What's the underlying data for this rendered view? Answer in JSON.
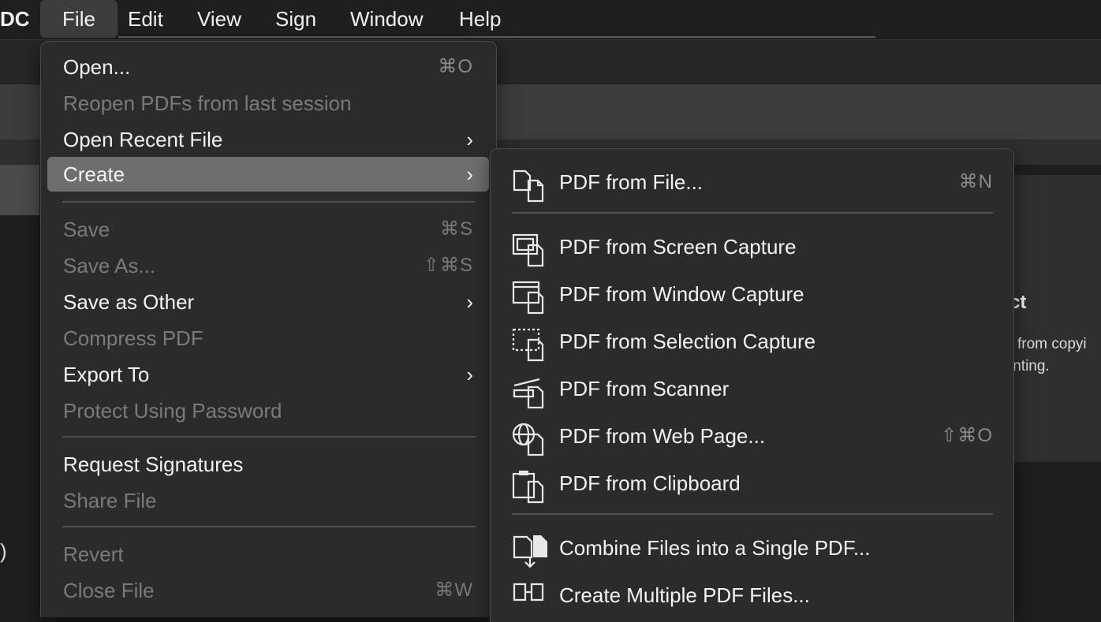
{
  "menubar": {
    "app_name": "DC",
    "items": [
      "File",
      "Edit",
      "View",
      "Sign",
      "Window",
      "Help"
    ]
  },
  "background": {
    "left_glyph": ")",
    "card_title_fragment": "ct",
    "card_text_line1": "from copyi",
    "card_text_line2": "inting."
  },
  "file_menu": {
    "open": {
      "label": "Open...",
      "shortcut": "⌘O"
    },
    "reopen": {
      "label": "Reopen PDFs from last session"
    },
    "open_recent": {
      "label": "Open Recent File"
    },
    "create": {
      "label": "Create"
    },
    "save": {
      "label": "Save",
      "shortcut": "⌘S"
    },
    "save_as": {
      "label": "Save As...",
      "shortcut": "⇧⌘S"
    },
    "save_as_other": {
      "label": "Save as Other"
    },
    "compress": {
      "label": "Compress PDF"
    },
    "export_to": {
      "label": "Export To"
    },
    "protect": {
      "label": "Protect Using Password"
    },
    "request_signatures": {
      "label": "Request Signatures"
    },
    "share_file": {
      "label": "Share File"
    },
    "revert": {
      "label": "Revert"
    },
    "close_file": {
      "label": "Close File",
      "shortcut": "⌘W"
    },
    "chevron": "›"
  },
  "create_submenu": {
    "pdf_from_file": {
      "label": "PDF from File...",
      "shortcut": "⌘N",
      "icon": "pdf-from-file-icon"
    },
    "screen_capture": {
      "label": "PDF from Screen Capture",
      "icon": "screen-capture-icon"
    },
    "window_capture": {
      "label": "PDF from Window Capture",
      "icon": "window-capture-icon"
    },
    "selection_capture": {
      "label": "PDF from Selection Capture",
      "icon": "selection-capture-icon"
    },
    "scanner": {
      "label": "PDF from Scanner",
      "icon": "scanner-icon"
    },
    "web_page": {
      "label": "PDF from Web Page...",
      "shortcut": "⇧⌘O",
      "icon": "globe-icon"
    },
    "clipboard": {
      "label": "PDF from Clipboard",
      "icon": "clipboard-icon"
    },
    "combine": {
      "label": "Combine Files into a Single PDF...",
      "icon": "combine-files-icon"
    },
    "multiple": {
      "label": "Create Multiple PDF Files...",
      "icon": "multiple-pdf-icon"
    }
  },
  "colors": {
    "menu_bg": "#2b2b2b",
    "selected_row": "#6e6e6e",
    "disabled_text": "#7a7a7a",
    "text": "#f2f2f2"
  }
}
